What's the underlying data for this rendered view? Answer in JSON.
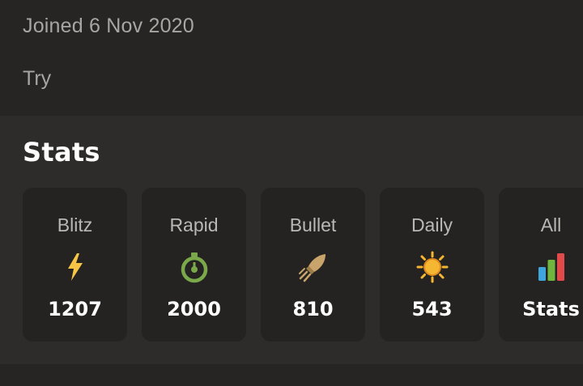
{
  "profile": {
    "joined": "Joined 6 Nov 2020",
    "bio": "Try"
  },
  "stats": {
    "title": "Stats",
    "cards": [
      {
        "label": "Blitz",
        "value": "1207",
        "icon": "lightning-icon",
        "color": "#f6c546"
      },
      {
        "label": "Rapid",
        "value": "2000",
        "icon": "stopwatch-icon",
        "color": "#7ba84a"
      },
      {
        "label": "Bullet",
        "value": "810",
        "icon": "bullet-icon",
        "color": "#c8a46a"
      },
      {
        "label": "Daily",
        "value": "543",
        "icon": "sun-icon",
        "color": "#f5b632"
      },
      {
        "label": "All",
        "value": "Stats",
        "icon": "bar-chart-icon",
        "colors": [
          "#3ea6dc",
          "#6fb53e",
          "#e04a4a"
        ]
      }
    ]
  }
}
